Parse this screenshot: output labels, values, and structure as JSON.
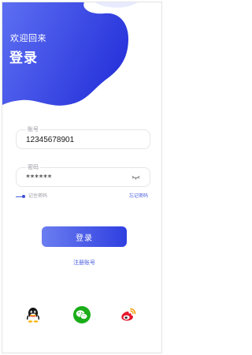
{
  "header": {
    "welcome": "欢迎回来",
    "title": "登录"
  },
  "form": {
    "account": {
      "label": "账号",
      "value": "12345678901"
    },
    "password": {
      "label": "密码",
      "value": "******"
    },
    "remember_label": "记住密码",
    "remember_checked": true,
    "forgot_label": "忘记密码"
  },
  "actions": {
    "login_label": "登录",
    "register_label": "注册账号"
  },
  "social": [
    {
      "name": "qq-icon"
    },
    {
      "name": "wechat-icon"
    },
    {
      "name": "weibo-icon"
    }
  ],
  "colors": {
    "accent": "#3f51e0",
    "accent_light": "#6b7df0",
    "link": "#4a5ee0",
    "wechat_green": "#1aad19",
    "weibo_red": "#e6162d",
    "weibo_orange": "#f39800"
  }
}
